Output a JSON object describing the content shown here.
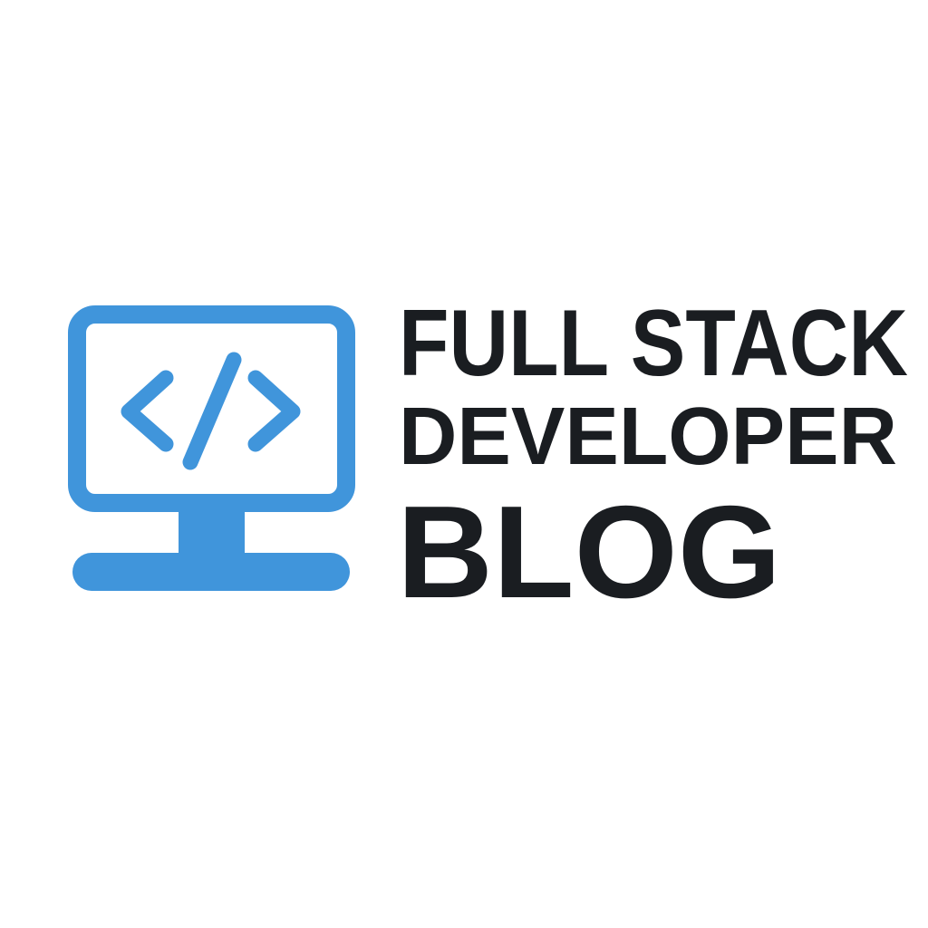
{
  "logo": {
    "icon": "monitor-code-icon",
    "line1": "FULL STACK",
    "line2": "DEVELOPER",
    "line3": "BLOG"
  },
  "colors": {
    "accent": "#4095DB",
    "text": "#1A1D21",
    "background": "#FFFFFF"
  }
}
